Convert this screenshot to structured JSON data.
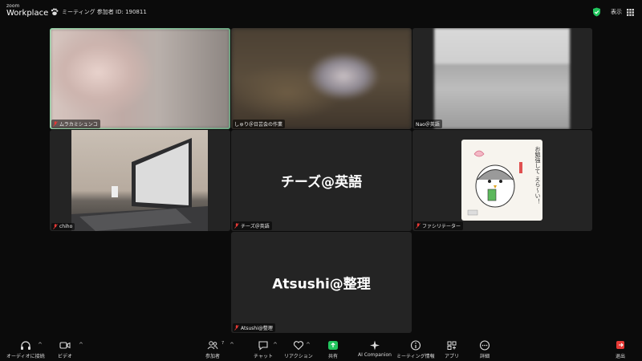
{
  "app": {
    "logo_top": "zoom",
    "logo_bottom": "Workplace"
  },
  "meeting": {
    "label": "ミーティング 参加者 ID: 190811"
  },
  "view": {
    "label": "表示"
  },
  "tiles": [
    {
      "name": "ムラカミシュンコ",
      "muted": true,
      "active": true
    },
    {
      "name": "しゅり＠日芸会の作業",
      "muted": false
    },
    {
      "name": "Nao＠英語",
      "muted": false
    },
    {
      "name": "chiho",
      "muted": true
    },
    {
      "name": "チーズ＠英語",
      "big": "チーズ@英語",
      "muted": true
    },
    {
      "name": "ファシリテーター",
      "muted": true
    },
    {
      "name": "Atsushi@整理",
      "big": "Atsushi@整理",
      "muted": true
    }
  ],
  "toolbar": {
    "audio": "オーディオに接続",
    "video": "ビデオ",
    "participants": "参加者",
    "participants_count": "7",
    "chat": "チャット",
    "reactions": "リアクション",
    "share": "共有",
    "ai": "AI Companion",
    "info": "ミーティング情報",
    "apps": "アプリ",
    "more": "詳細",
    "leave": "退出"
  },
  "sticker": {
    "lines": "お勉強して えら～い！"
  },
  "colors": {
    "accent_green": "#3ddc84",
    "share_green": "#22c55e",
    "leave_red": "#e53935",
    "tile_bg": "#242424"
  }
}
